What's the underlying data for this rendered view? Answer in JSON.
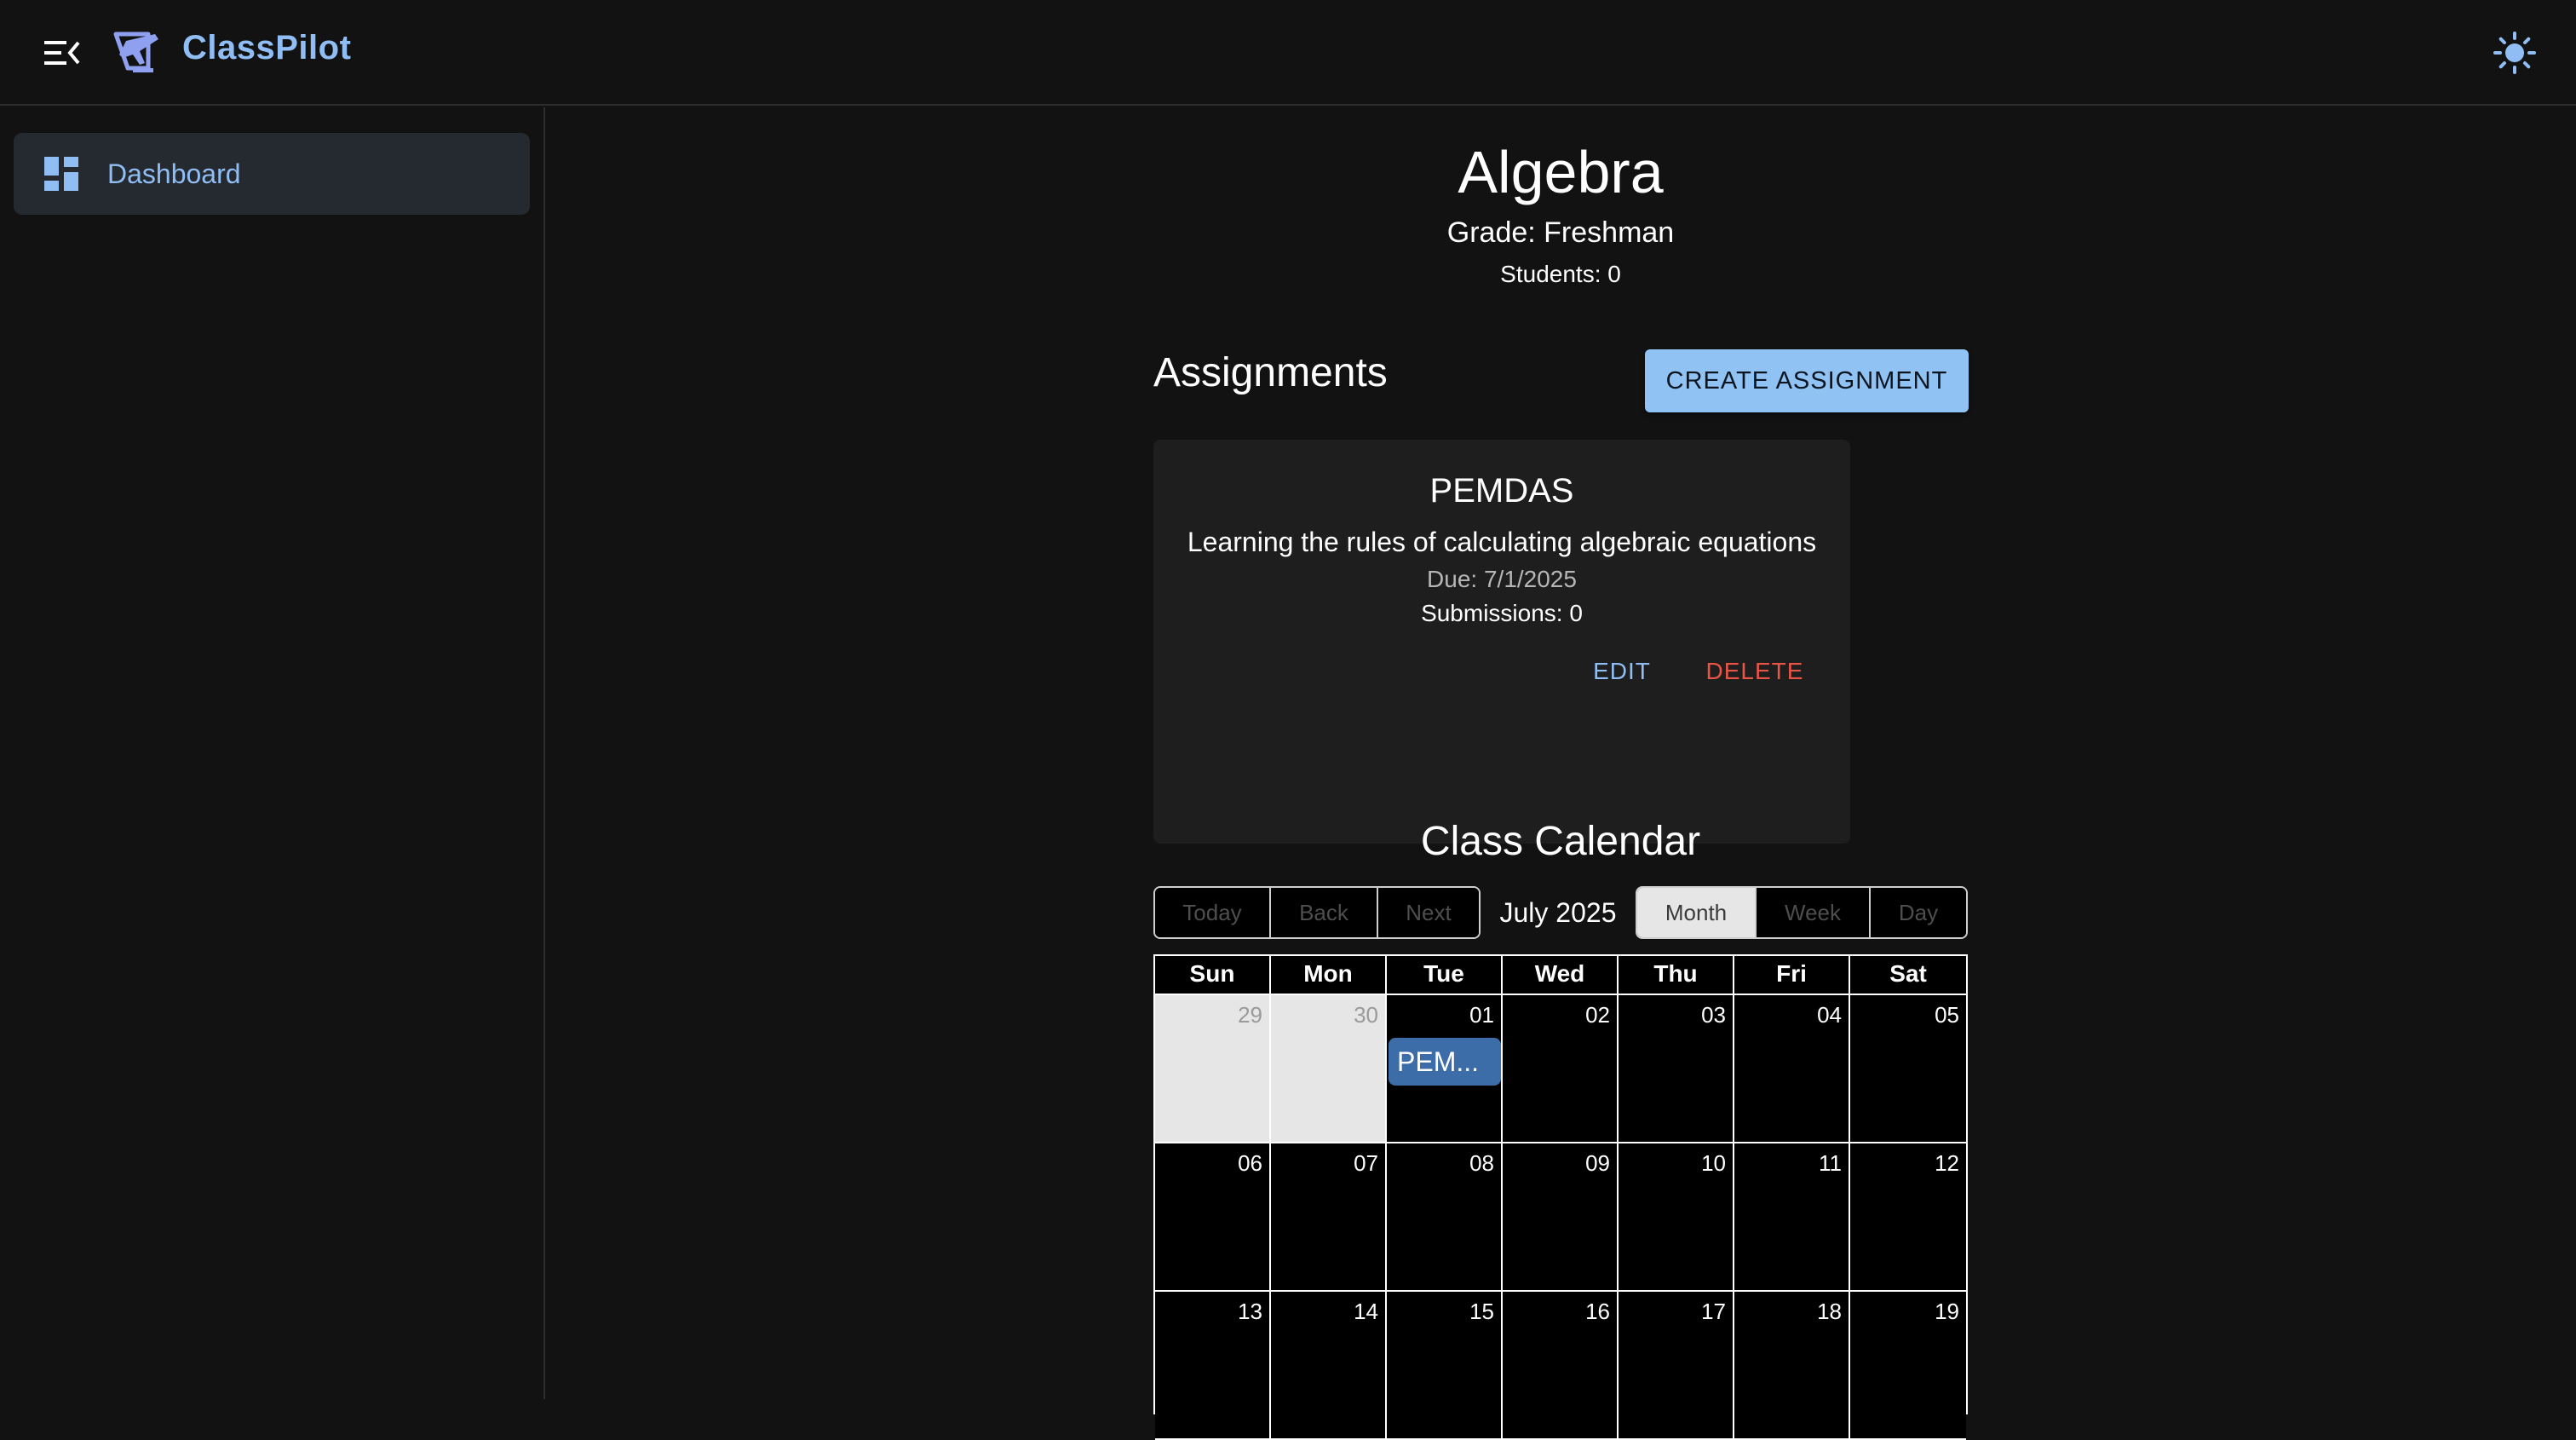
{
  "app": {
    "name": "ClassPilot",
    "brand_color": "#90bef4"
  },
  "sidebar": {
    "items": [
      {
        "label": "Dashboard",
        "icon": "dashboard-icon",
        "active": true
      }
    ]
  },
  "course": {
    "title": "Algebra",
    "grade": "Grade: Freshman",
    "students": "Students: 0"
  },
  "assignments": {
    "heading": "Assignments",
    "create_label": "CREATE ASSIGNMENT",
    "items": [
      {
        "title": "PEMDAS",
        "description": "Learning the rules of calculating algebraic equations",
        "due": "Due: 7/1/2025",
        "submissions": "Submissions: 0",
        "edit_label": "EDIT",
        "delete_label": "DELETE"
      }
    ]
  },
  "calendar": {
    "heading": "Class Calendar",
    "nav": {
      "today": "Today",
      "back": "Back",
      "next": "Next"
    },
    "label": "July 2025",
    "views": {
      "month": "Month",
      "week": "Week",
      "day": "Day",
      "active": "month"
    },
    "weekdays": [
      "Sun",
      "Mon",
      "Tue",
      "Wed",
      "Thu",
      "Fri",
      "Sat"
    ],
    "weeks": [
      [
        "29",
        "30",
        "01",
        "02",
        "03",
        "04",
        "05"
      ],
      [
        "06",
        "07",
        "08",
        "09",
        "10",
        "11",
        "12"
      ],
      [
        "13",
        "14",
        "15",
        "16",
        "17",
        "18",
        "19"
      ]
    ],
    "off_range_days": [
      "29",
      "30"
    ],
    "event": {
      "label": "PEM...",
      "date": "01",
      "color": "#3c6da8"
    }
  },
  "colors": {
    "background": "#121212",
    "accent": "#90c3f4",
    "danger": "#e85446"
  }
}
